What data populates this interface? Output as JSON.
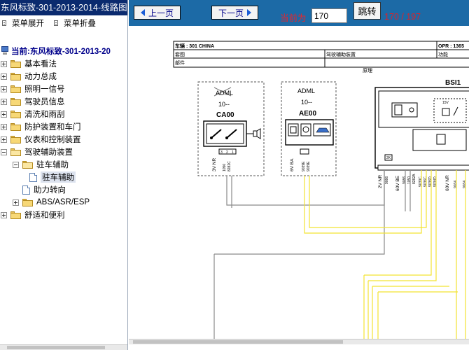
{
  "sidebar": {
    "title": "东风标致-301-2013-2014-线路图",
    "expand_label": "菜单展开",
    "collapse_label": "菜单折叠",
    "root_label": "当前:东风标致-301-2013-20",
    "items": [
      {
        "label": "基本看法"
      },
      {
        "label": "动力总成"
      },
      {
        "label": "照明一信号"
      },
      {
        "label": "驾驶员信息"
      },
      {
        "label": "清洗和雨刮"
      },
      {
        "label": "防护装置和车门"
      },
      {
        "label": "仪表和控制装置"
      },
      {
        "label": "驾驶辅助装置"
      },
      {
        "label": "驻车辅助"
      },
      {
        "label": "驻车辅助"
      },
      {
        "label": "助力转向"
      },
      {
        "label": "ABS/ASR/ESP"
      },
      {
        "label": "舒适和便利"
      }
    ]
  },
  "toolbar": {
    "prev_label": "上一页",
    "next_label": "下一页",
    "current_label": "当前为",
    "page_value": "170",
    "jump_label": "跳转",
    "page_count": "170 / 197"
  },
  "diagram": {
    "vehicle_label": "车辆 : 301 CHINA",
    "opr_label": "OPR : 1365",
    "group_label": "套图",
    "function_label": "驾驶辅助装置",
    "feature_label": "功能",
    "part_label": "部件",
    "principle_label": "原理",
    "ca_top": "ADML",
    "ca_10": "10--",
    "ca_code": "CA00",
    "ae_top": "ADML",
    "ae_10": "10--",
    "ae_code": "AE00",
    "bsi_code": "BSI1",
    "ca_conn": "3V NR",
    "ca_w1": "1050",
    "ca_w2": "8282C",
    "ca_pins": [
      "3",
      "2",
      "1"
    ],
    "ae_conn": "6V BA",
    "ae_w1": "9039E",
    "ae_w2": "9039E",
    "bsi_conns": [
      "2V NR",
      "60V BE",
      "60V NR"
    ],
    "bsi_wires": [
      "9086",
      "9086",
      "1050",
      "8282A",
      "9039C",
      "9036C",
      "9036D",
      "9034D",
      "9034",
      "9034"
    ],
    "bsi_fuse": "15V",
    "bsi_pin": "2K"
  }
}
